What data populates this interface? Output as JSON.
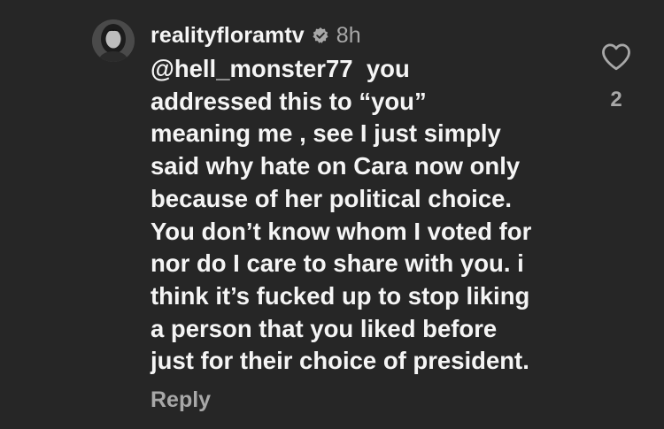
{
  "comment": {
    "username": "realityfloramtv",
    "timestamp": "8h",
    "mention": "@hell_monster77",
    "lines": [
      "you",
      "addressed this to “you”",
      "meaning me , see I just simply",
      "said why hate on Cara now only",
      "because of her political choice.",
      "You don’t know whom I voted for",
      "nor do I care to share with you. i",
      "think it’s fucked up to stop liking",
      "a person that you liked before",
      "just for their choice of president."
    ],
    "reply_label": "Reply",
    "like_count": "2",
    "verified_icon": "verified-badge-icon",
    "like_icon": "heart-outline-icon"
  },
  "colors": {
    "background": "#262626",
    "primary_text": "#f5f5f5",
    "secondary_text": "#a8a8a8"
  }
}
